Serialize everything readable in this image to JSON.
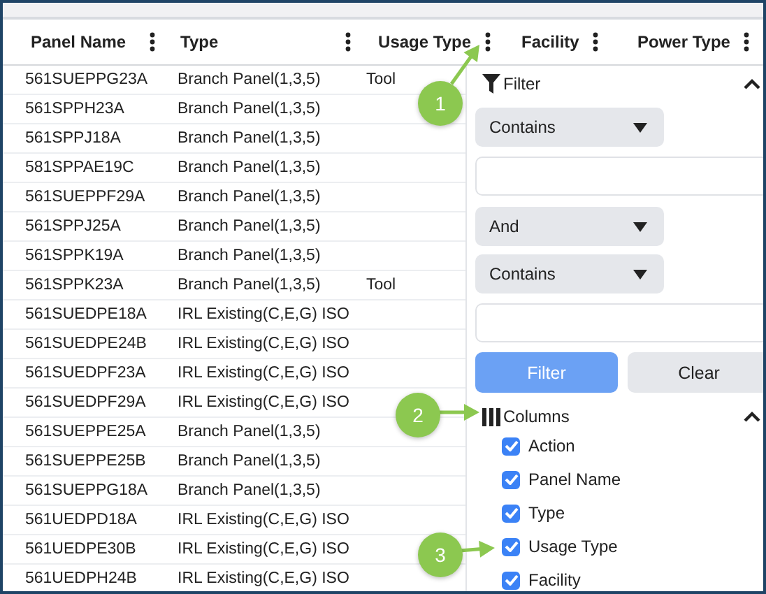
{
  "table": {
    "columns": [
      {
        "label": "Panel Name"
      },
      {
        "label": "Type"
      },
      {
        "label": "Usage Type"
      },
      {
        "label": "Facility"
      },
      {
        "label": "Power Type"
      }
    ],
    "rows": [
      {
        "panel_name": "561SUEPPG23A",
        "type": "Branch Panel(1,3,5)",
        "usage_type": "Tool"
      },
      {
        "panel_name": "561SPPH23A",
        "type": "Branch Panel(1,3,5)"
      },
      {
        "panel_name": "561SPPJ18A",
        "type": "Branch Panel(1,3,5)"
      },
      {
        "panel_name": "581SPPAE19C",
        "type": "Branch Panel(1,3,5)"
      },
      {
        "panel_name": "561SUEPPF29A",
        "type": "Branch Panel(1,3,5)"
      },
      {
        "panel_name": "561SPPJ25A",
        "type": "Branch Panel(1,3,5)"
      },
      {
        "panel_name": "561SPPK19A",
        "type": "Branch Panel(1,3,5)"
      },
      {
        "panel_name": "561SPPK23A",
        "type": "Branch Panel(1,3,5)",
        "usage_type": "Tool"
      },
      {
        "panel_name": "561SUEDPE18A",
        "type": "IRL Existing(C,E,G) ISO"
      },
      {
        "panel_name": "561SUEDPE24B",
        "type": "IRL Existing(C,E,G) ISO"
      },
      {
        "panel_name": "561SUEDPF23A",
        "type": "IRL Existing(C,E,G) ISO"
      },
      {
        "panel_name": "561SUEDPF29A",
        "type": "IRL Existing(C,E,G) ISO"
      },
      {
        "panel_name": "561SUEPPE25A",
        "type": "Branch Panel(1,3,5)"
      },
      {
        "panel_name": "561SUEPPE25B",
        "type": "Branch Panel(1,3,5)"
      },
      {
        "panel_name": "561SUEPPG18A",
        "type": "Branch Panel(1,3,5)"
      },
      {
        "panel_name": "561UEDPD18A",
        "type": "IRL Existing(C,E,G) ISO"
      },
      {
        "panel_name": "561UEDPE30B",
        "type": "IRL Existing(C,E,G) ISO"
      },
      {
        "panel_name": "561UEDPH24B",
        "type": "IRL Existing(C,E,G) ISO"
      }
    ]
  },
  "column_menu": {
    "filter": {
      "title": "Filter",
      "expanded": true,
      "operator_1": "Contains",
      "logic": "And",
      "operator_2": "Contains",
      "buttons": [
        {
          "label": "Filter",
          "kind": "primary"
        },
        {
          "label": "Clear",
          "kind": "secondary"
        }
      ]
    },
    "columns": {
      "title": "Columns",
      "expanded": true,
      "items": [
        {
          "label": "Action",
          "checked": true
        },
        {
          "label": "Panel Name",
          "checked": true
        },
        {
          "label": "Type",
          "checked": true
        },
        {
          "label": "Usage Type",
          "checked": true
        },
        {
          "label": "Facility",
          "checked": true
        }
      ]
    }
  },
  "callouts": [
    {
      "number": "1"
    },
    {
      "number": "2"
    },
    {
      "number": "3"
    }
  ]
}
